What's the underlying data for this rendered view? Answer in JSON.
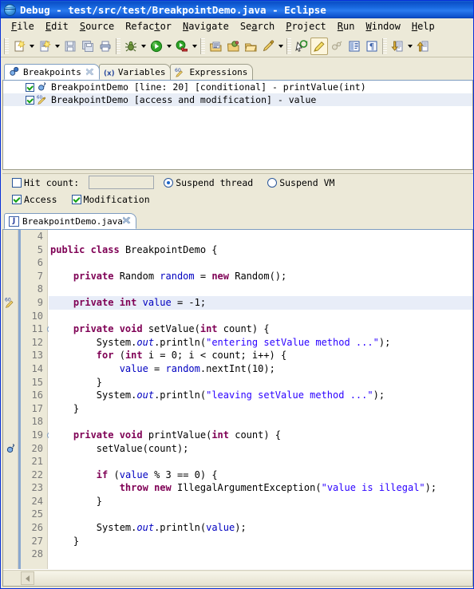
{
  "window": {
    "title": "Debug - test/src/test/BreakpointDemo.java - Eclipse",
    "icon": "eclipse-globe-icon",
    "title_bg": "#0b4fc8"
  },
  "menubar": {
    "items": [
      {
        "label": "File",
        "mnemonic": "F"
      },
      {
        "label": "Edit",
        "mnemonic": "E"
      },
      {
        "label": "Source",
        "mnemonic": "S"
      },
      {
        "label": "Refactor",
        "mnemonic": "t"
      },
      {
        "label": "Navigate",
        "mnemonic": "N"
      },
      {
        "label": "Search",
        "mnemonic": "a"
      },
      {
        "label": "Project",
        "mnemonic": "P"
      },
      {
        "label": "Run",
        "mnemonic": "R"
      },
      {
        "label": "Window",
        "mnemonic": "W"
      },
      {
        "label": "Help",
        "mnemonic": "H"
      }
    ]
  },
  "toolbar": {
    "groups": [
      {
        "items": [
          {
            "icon": "new-java-file-icon",
            "dropdown": true
          },
          {
            "icon": "new-java-class-icon",
            "dropdown": true
          },
          {
            "icon": "save-icon",
            "dropdown": false
          },
          {
            "icon": "save-all-icon",
            "dropdown": false
          },
          {
            "icon": "print-icon",
            "dropdown": false
          }
        ]
      },
      {
        "items": [
          {
            "icon": "debug-bug-icon",
            "dropdown": true
          },
          {
            "icon": "run-green-play-icon",
            "dropdown": true
          },
          {
            "icon": "run-external-tools-icon",
            "dropdown": true
          }
        ]
      },
      {
        "items": [
          {
            "icon": "open-type-icon",
            "dropdown": false
          },
          {
            "icon": "search-package-icon",
            "dropdown": false
          },
          {
            "icon": "open-resource-icon",
            "dropdown": false
          },
          {
            "icon": "quick-fix-pencil-icon",
            "dropdown": true
          }
        ]
      },
      {
        "items": [
          {
            "icon": "next-annotation-icon",
            "dropdown": false
          },
          {
            "icon": "highlight-marker-icon",
            "dropdown": false,
            "selected": true
          },
          {
            "icon": "toggle-mark-occurrences-icon",
            "dropdown": false
          },
          {
            "icon": "show-whitespace-icon",
            "dropdown": false
          },
          {
            "icon": "pilcrow-icon",
            "dropdown": false
          }
        ]
      },
      {
        "items": [
          {
            "icon": "previous-edit-location-icon",
            "dropdown": true
          },
          {
            "icon": "next-edit-location-icon",
            "dropdown": false
          }
        ]
      }
    ]
  },
  "breakpoints_view": {
    "tabs": [
      {
        "label": "Breakpoints",
        "icon": "breakpoints-icon",
        "active": true,
        "closable": true
      },
      {
        "label": "Variables",
        "icon": "variables-icon",
        "active": false,
        "closable": false
      },
      {
        "label": "Expressions",
        "icon": "expressions-icon",
        "active": false,
        "closable": false
      }
    ],
    "rows": [
      {
        "checked": true,
        "icon": "line-breakpoint-conditional-icon",
        "label": "BreakpointDemo [line: 20] [conditional] - printValue(int)",
        "selected": false
      },
      {
        "checked": true,
        "icon": "watchpoint-icon",
        "label": "BreakpointDemo [access and modification] - value",
        "selected": true
      }
    ],
    "properties": {
      "hit_count": {
        "label": "Hit count:",
        "checked": false,
        "value": "",
        "placeholder": ""
      },
      "suspend_policy": {
        "options": [
          {
            "label": "Suspend thread",
            "selected": true
          },
          {
            "label": "Suspend VM",
            "selected": false
          }
        ]
      },
      "access": {
        "label": "Access",
        "checked": true
      },
      "modification": {
        "label": "Modification",
        "checked": true
      }
    }
  },
  "editor": {
    "tabs": [
      {
        "label": "BreakpointDemo.java",
        "icon": "java-file-icon",
        "active": true,
        "closable": true
      }
    ],
    "first_line": 4,
    "scrollbar": {
      "left_arrow": "scroll-left-icon"
    },
    "lines": [
      {
        "n": 4,
        "marker": "",
        "fold": false,
        "highlight": false,
        "tokens": []
      },
      {
        "n": 5,
        "marker": "",
        "fold": false,
        "highlight": false,
        "tokens": [
          {
            "t": "public ",
            "c": "kw"
          },
          {
            "t": "class ",
            "c": "kw"
          },
          {
            "t": "BreakpointDemo {",
            "c": ""
          }
        ]
      },
      {
        "n": 6,
        "marker": "",
        "fold": false,
        "highlight": false,
        "tokens": []
      },
      {
        "n": 7,
        "marker": "",
        "fold": false,
        "highlight": false,
        "tokens": [
          {
            "t": "    ",
            "c": ""
          },
          {
            "t": "private ",
            "c": "kw"
          },
          {
            "t": "Random ",
            "c": ""
          },
          {
            "t": "random",
            "c": "fld"
          },
          {
            "t": " = ",
            "c": ""
          },
          {
            "t": "new ",
            "c": "kw"
          },
          {
            "t": "Random();",
            "c": ""
          }
        ]
      },
      {
        "n": 8,
        "marker": "",
        "fold": false,
        "highlight": false,
        "tokens": []
      },
      {
        "n": 9,
        "marker": "watchpoint",
        "fold": false,
        "highlight": true,
        "tokens": [
          {
            "t": "    ",
            "c": ""
          },
          {
            "t": "private ",
            "c": "kw"
          },
          {
            "t": "int ",
            "c": "kw"
          },
          {
            "t": "value",
            "c": "fld"
          },
          {
            "t": " = -1;",
            "c": ""
          }
        ]
      },
      {
        "n": 10,
        "marker": "",
        "fold": false,
        "highlight": false,
        "tokens": []
      },
      {
        "n": 11,
        "marker": "",
        "fold": true,
        "highlight": false,
        "tokens": [
          {
            "t": "    ",
            "c": ""
          },
          {
            "t": "private ",
            "c": "kw"
          },
          {
            "t": "void ",
            "c": "kw"
          },
          {
            "t": "setValue(",
            "c": ""
          },
          {
            "t": "int ",
            "c": "kw"
          },
          {
            "t": "count) {",
            "c": ""
          }
        ]
      },
      {
        "n": 12,
        "marker": "",
        "fold": false,
        "highlight": false,
        "tokens": [
          {
            "t": "        System.",
            "c": ""
          },
          {
            "t": "out",
            "c": "sfld"
          },
          {
            "t": ".println(",
            "c": ""
          },
          {
            "t": "\"entering setValue method ...\"",
            "c": "str"
          },
          {
            "t": ");",
            "c": ""
          }
        ]
      },
      {
        "n": 13,
        "marker": "",
        "fold": false,
        "highlight": false,
        "tokens": [
          {
            "t": "        ",
            "c": ""
          },
          {
            "t": "for ",
            "c": "kw"
          },
          {
            "t": "(",
            "c": ""
          },
          {
            "t": "int ",
            "c": "kw"
          },
          {
            "t": "i = 0; i < count; i++) {",
            "c": ""
          }
        ]
      },
      {
        "n": 14,
        "marker": "",
        "fold": false,
        "highlight": false,
        "tokens": [
          {
            "t": "            ",
            "c": ""
          },
          {
            "t": "value",
            "c": "fld"
          },
          {
            "t": " = ",
            "c": ""
          },
          {
            "t": "random",
            "c": "fld"
          },
          {
            "t": ".nextInt(10);",
            "c": ""
          }
        ]
      },
      {
        "n": 15,
        "marker": "",
        "fold": false,
        "highlight": false,
        "tokens": [
          {
            "t": "        }",
            "c": ""
          }
        ]
      },
      {
        "n": 16,
        "marker": "",
        "fold": false,
        "highlight": false,
        "tokens": [
          {
            "t": "        System.",
            "c": ""
          },
          {
            "t": "out",
            "c": "sfld"
          },
          {
            "t": ".println(",
            "c": ""
          },
          {
            "t": "\"leaving setValue method ...\"",
            "c": "str"
          },
          {
            "t": ");",
            "c": ""
          }
        ]
      },
      {
        "n": 17,
        "marker": "",
        "fold": false,
        "highlight": false,
        "tokens": [
          {
            "t": "    }",
            "c": ""
          }
        ]
      },
      {
        "n": 18,
        "marker": "",
        "fold": false,
        "highlight": false,
        "tokens": []
      },
      {
        "n": 19,
        "marker": "",
        "fold": true,
        "highlight": false,
        "tokens": [
          {
            "t": "    ",
            "c": ""
          },
          {
            "t": "private ",
            "c": "kw"
          },
          {
            "t": "void ",
            "c": "kw"
          },
          {
            "t": "printValue(",
            "c": ""
          },
          {
            "t": "int ",
            "c": "kw"
          },
          {
            "t": "count) {",
            "c": ""
          }
        ]
      },
      {
        "n": 20,
        "marker": "breakpoint",
        "fold": false,
        "highlight": false,
        "tokens": [
          {
            "t": "        setValue(count);",
            "c": ""
          }
        ]
      },
      {
        "n": 21,
        "marker": "",
        "fold": false,
        "highlight": false,
        "tokens": []
      },
      {
        "n": 22,
        "marker": "",
        "fold": false,
        "highlight": false,
        "tokens": [
          {
            "t": "        ",
            "c": ""
          },
          {
            "t": "if ",
            "c": "kw"
          },
          {
            "t": "(",
            "c": ""
          },
          {
            "t": "value",
            "c": "fld"
          },
          {
            "t": " % 3 == 0) {",
            "c": ""
          }
        ]
      },
      {
        "n": 23,
        "marker": "",
        "fold": false,
        "highlight": false,
        "tokens": [
          {
            "t": "            ",
            "c": ""
          },
          {
            "t": "throw ",
            "c": "kw"
          },
          {
            "t": "new ",
            "c": "kw"
          },
          {
            "t": "IllegalArgumentException(",
            "c": ""
          },
          {
            "t": "\"value is illegal\"",
            "c": "str"
          },
          {
            "t": ");",
            "c": ""
          }
        ]
      },
      {
        "n": 24,
        "marker": "",
        "fold": false,
        "highlight": false,
        "tokens": [
          {
            "t": "        }",
            "c": ""
          }
        ]
      },
      {
        "n": 25,
        "marker": "",
        "fold": false,
        "highlight": false,
        "tokens": []
      },
      {
        "n": 26,
        "marker": "",
        "fold": false,
        "highlight": false,
        "tokens": [
          {
            "t": "        System.",
            "c": ""
          },
          {
            "t": "out",
            "c": "sfld"
          },
          {
            "t": ".println(",
            "c": ""
          },
          {
            "t": "value",
            "c": "fld"
          },
          {
            "t": ");",
            "c": ""
          }
        ]
      },
      {
        "n": 27,
        "marker": "",
        "fold": false,
        "highlight": false,
        "tokens": [
          {
            "t": "    }",
            "c": ""
          }
        ]
      },
      {
        "n": 28,
        "marker": "",
        "fold": false,
        "highlight": false,
        "tokens": []
      }
    ]
  },
  "colors": {
    "keyword": "#7f0055",
    "string": "#2a00ff",
    "field": "#0000c0",
    "highlight_line": "#e8edf8",
    "chrome": "#ece9d8"
  }
}
